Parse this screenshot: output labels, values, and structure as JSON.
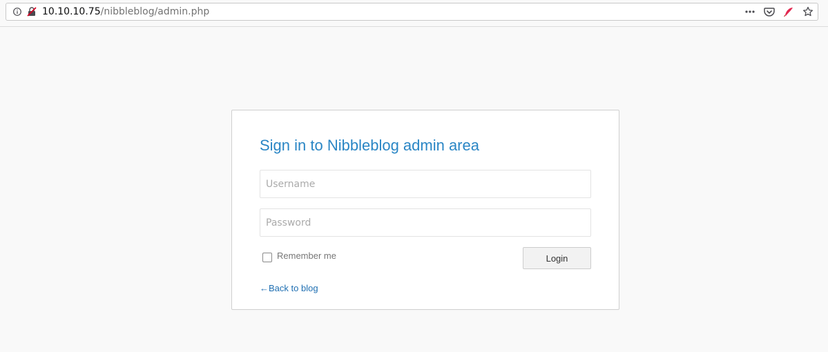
{
  "browser": {
    "url_host": "10.10.10.75",
    "url_path": "/nibbleblog/admin.php",
    "icons": {
      "info": "info-icon",
      "insecure": "insecure-connection-icon",
      "more": "more-actions-icon",
      "pocket": "pocket-icon",
      "extension": "feather-extension-icon",
      "bookmark": "star-bookmark-icon"
    }
  },
  "login": {
    "title": "Sign in to Nibbleblog admin area",
    "username_placeholder": "Username",
    "username_value": "",
    "password_placeholder": "Password",
    "password_value": "",
    "remember_label": "Remember me",
    "remember_checked": false,
    "login_button": "Login",
    "back_link": "←Back to blog"
  },
  "colors": {
    "accent": "#2a86c5",
    "link": "#1f6fb2",
    "background": "#f9f9f9"
  }
}
